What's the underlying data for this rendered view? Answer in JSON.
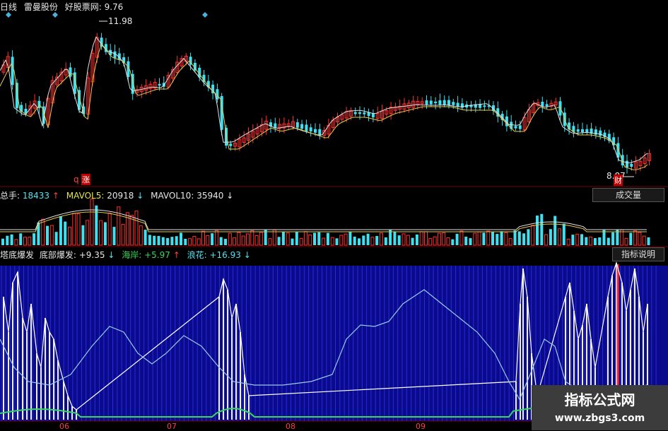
{
  "price_panel": {
    "header": {
      "period": "日线",
      "stock": "雷曼股份",
      "source_label": "好股票网:",
      "source_value": "9.76"
    },
    "high_label": "11.98",
    "low_label": "8.87",
    "left_badge": "q",
    "rise_badge": "涨",
    "low_badge": "财"
  },
  "volume_panel": {
    "total_label": "总手:",
    "total_value": "18433",
    "total_arrow": "↑",
    "mavol5_label": "MAVOL5:",
    "mavol5_value": "20918",
    "mavol5_arrow": "↓",
    "mavol10_label": "MAVOL10:",
    "mavol10_value": "35940",
    "mavol10_arrow": "↓",
    "button": "成交量"
  },
  "indicator_panel": {
    "name": "塔底爆发",
    "label1": "底部爆发:",
    "value1": "+9.35",
    "arrow1": "↓",
    "label2": "海岸:",
    "value2": "+5.97",
    "arrow2": "↑",
    "label3": "浪花:",
    "value3": "+16.93",
    "arrow3": "↓",
    "button": "指标说明"
  },
  "x_axis": {
    "labels": [
      "06",
      "07",
      "08",
      "09"
    ]
  },
  "watermark": {
    "title": "指标公式网",
    "url": "www.zbgs3.com"
  },
  "colors": {
    "up": "#ff3030",
    "down": "#40e0f0",
    "panel_bg": "#0a0a8c",
    "grid": "#7a0000"
  }
}
